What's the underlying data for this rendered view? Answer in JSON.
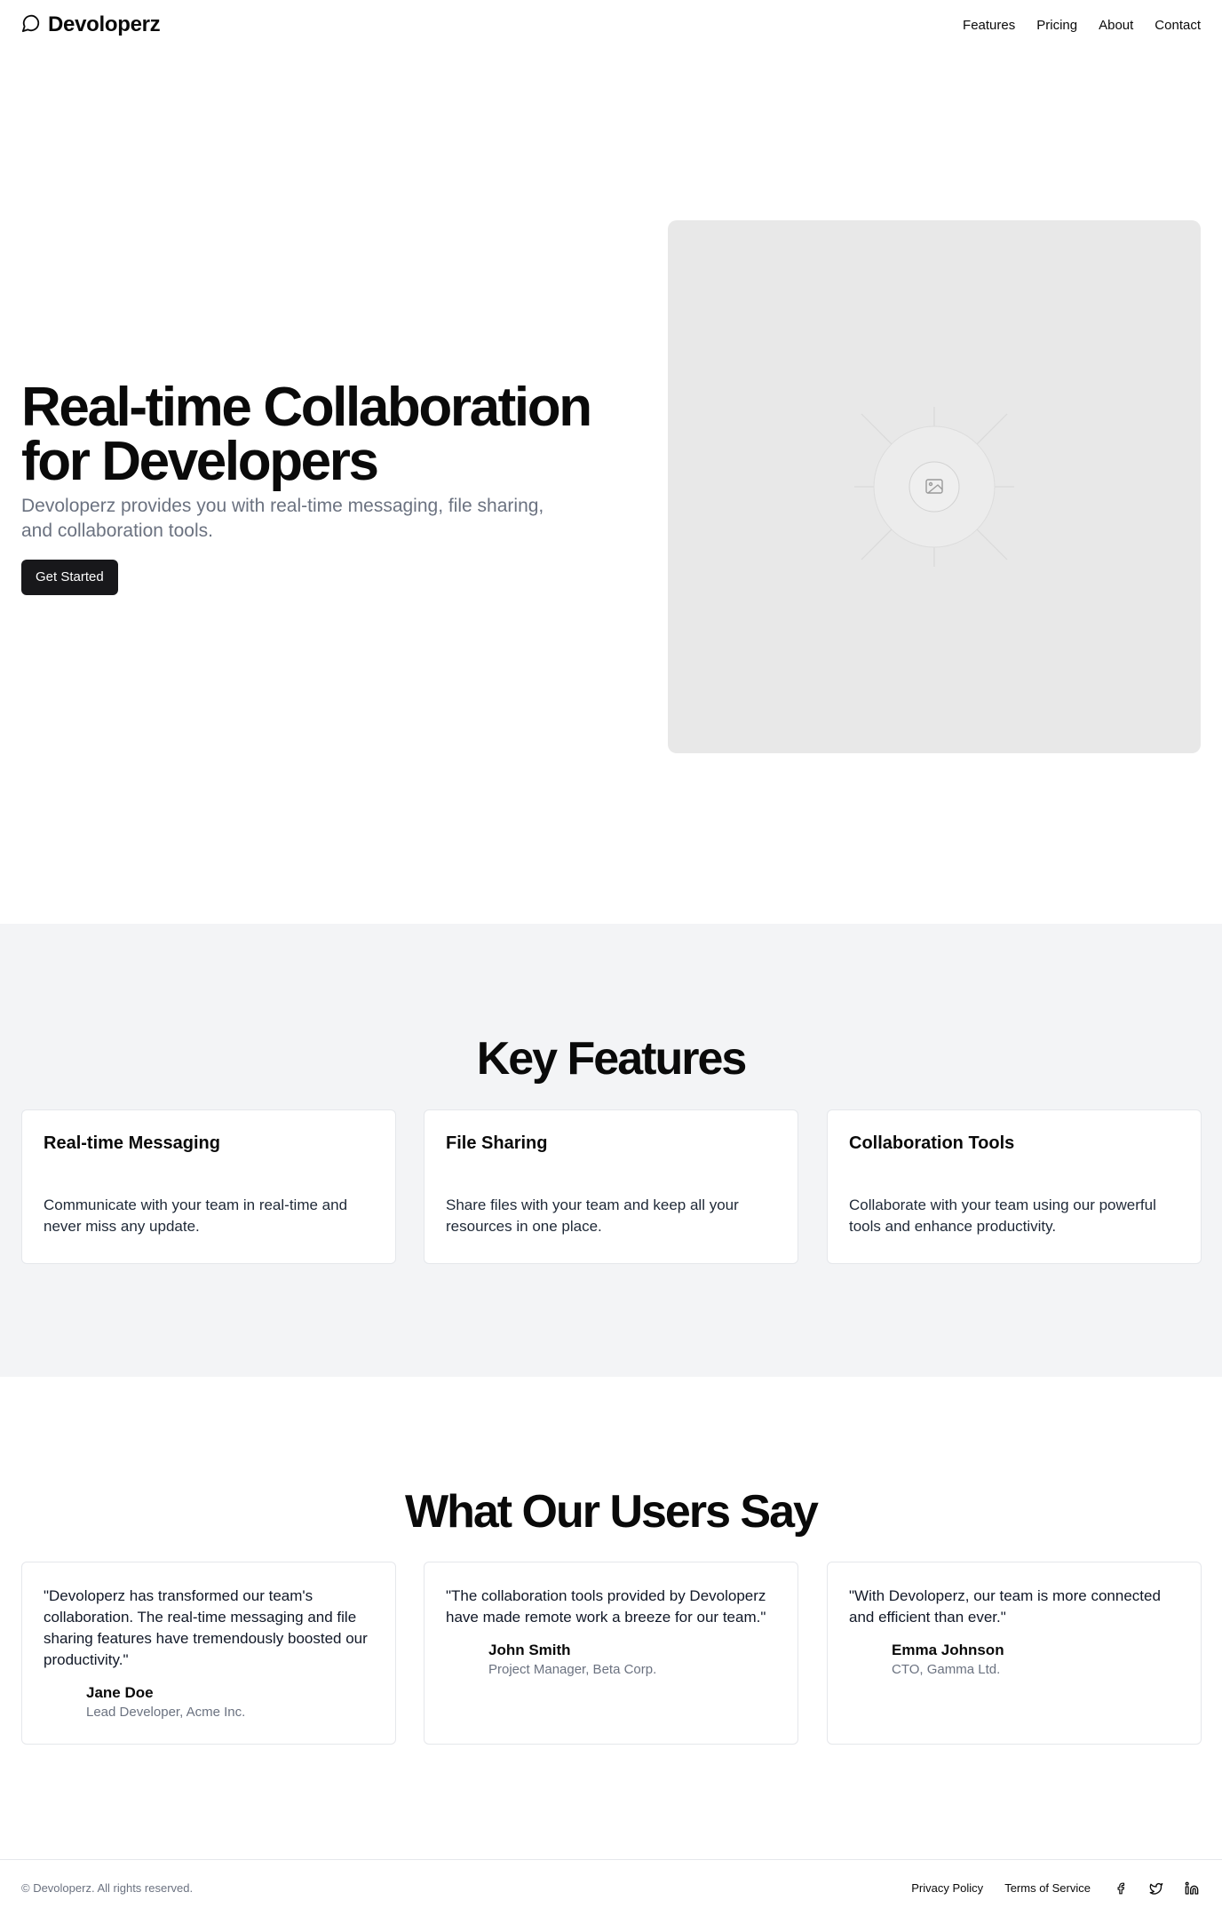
{
  "header": {
    "brand": "Devoloperz",
    "logo_icon": "message-circle-icon",
    "nav": [
      "Features",
      "Pricing",
      "About",
      "Contact"
    ]
  },
  "hero": {
    "title": "Real-time Collaboration for Developers",
    "subtitle": "Devoloperz provides you with real-time messaging, file sharing, and collaboration tools.",
    "cta": "Get Started",
    "image_icon": "image-placeholder-icon"
  },
  "features": {
    "title": "Key Features",
    "items": [
      {
        "title": "Real-time Messaging",
        "text": "Communicate with your team in real-time and never miss any update."
      },
      {
        "title": "File Sharing",
        "text": "Share files with your team and keep all your resources in one place."
      },
      {
        "title": "Collaboration Tools",
        "text": "Collaborate with your team using our powerful tools and enhance productivity."
      }
    ]
  },
  "testimonials": {
    "title": "What Our Users Say",
    "items": [
      {
        "quote": "\"Devoloperz has transformed our team's collaboration. The real-time messaging and file sharing features have tremendously boosted our productivity.\"",
        "name": "Jane Doe",
        "role": "Lead Developer, Acme Inc."
      },
      {
        "quote": "\"The collaboration tools provided by Devoloperz have made remote work a breeze for our team.\"",
        "name": "John Smith",
        "role": "Project Manager, Beta Corp."
      },
      {
        "quote": "\"With Devoloperz, our team is more connected and efficient than ever.\"",
        "name": "Emma Johnson",
        "role": "CTO, Gamma Ltd."
      }
    ]
  },
  "footer": {
    "copyright": "© Devoloperz. All rights reserved.",
    "links": [
      "Privacy Policy",
      "Terms of Service"
    ],
    "social_icons": [
      "facebook-icon",
      "twitter-icon",
      "linkedin-icon"
    ]
  },
  "colors": {
    "primary": "#18181b",
    "muted_text": "#6b7280",
    "section_bg": "#f3f4f6",
    "placeholder_bg": "#e8e8e8"
  }
}
